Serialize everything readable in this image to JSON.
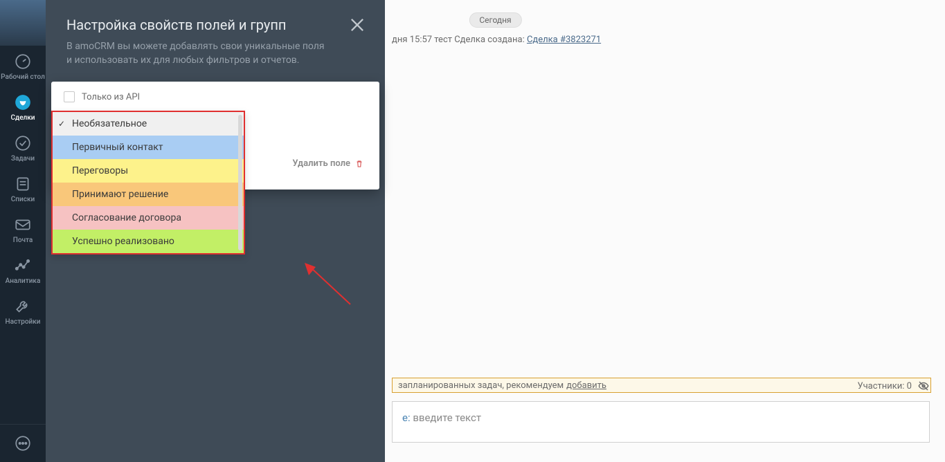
{
  "sidebar": {
    "items": [
      {
        "label": "Рабочий стол"
      },
      {
        "label": "Сделки"
      },
      {
        "label": "Задачи"
      },
      {
        "label": "Списки"
      },
      {
        "label": "Почта"
      },
      {
        "label": "Аналитика"
      },
      {
        "label": "Настройки"
      }
    ]
  },
  "overlay": {
    "title": "Настройка свойств полей и групп",
    "subtitle": "В amoCRM вы можете добавлять свои уникальные поля и использовать их для любых фильтров и отчетов.",
    "api_only_label": "Только из API",
    "delete_field_label": "Удалить поле",
    "options": [
      {
        "label": "Необязательное",
        "selected": true,
        "cls": "sel"
      },
      {
        "label": "Первичный контакт",
        "cls": "blue"
      },
      {
        "label": "Переговоры",
        "cls": "yellow"
      },
      {
        "label": "Принимают решение",
        "cls": "orange"
      },
      {
        "label": "Согласование договора",
        "cls": "pink"
      },
      {
        "label": "Успешно реализовано",
        "cls": "green"
      }
    ]
  },
  "feed": {
    "today_chip": "Сегодня",
    "line_prefix": "дня 15:57 тест  Сделка создана:  ",
    "deal_link": "Сделка #3823271",
    "recommend_text": "запланированных задач, рекомендуем ",
    "recommend_link": "добавить",
    "participants_label": "Участники: 0",
    "note_prefix": "е:",
    "note_placeholder": " введите текст"
  }
}
